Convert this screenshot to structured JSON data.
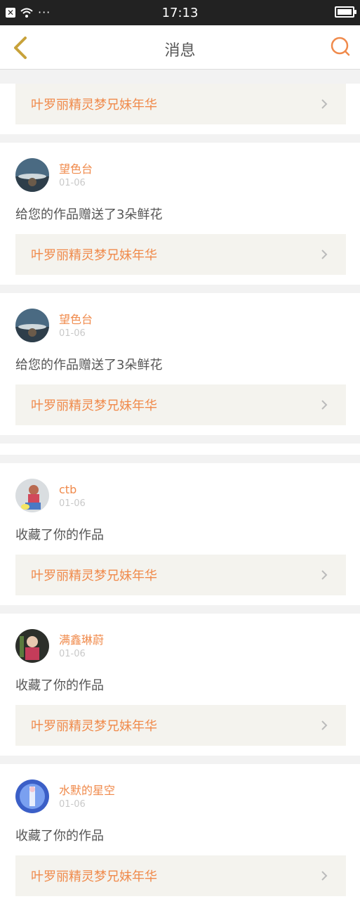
{
  "status": {
    "time": "17:13",
    "x": "✕",
    "dots": "···"
  },
  "nav": {
    "title": "消息",
    "back_icon": "chevron-left-icon",
    "search_icon": "search-icon"
  },
  "colors": {
    "accent": "#f08a4b",
    "card_bg": "#ffffff",
    "page_bg": "#f2f2f2",
    "work_bg": "#f4f3ee"
  },
  "partial_card": {
    "work_title": "叶罗丽精灵梦兄妹年华"
  },
  "notifications": [
    {
      "username": "望色台",
      "date": "01-06",
      "message": "给您的作品赠送了3朵鲜花",
      "work_title": "叶罗丽精灵梦兄妹年华",
      "avatar_icon": "avatar-landscape"
    },
    {
      "username": "望色台",
      "date": "01-06",
      "message": "给您的作品赠送了3朵鲜花",
      "work_title": "叶罗丽精灵梦兄妹年华",
      "avatar_icon": "avatar-landscape"
    },
    {
      "username": "ctb",
      "date": "01-06",
      "message": "收藏了你的作品",
      "work_title": "叶罗丽精灵梦兄妹年华",
      "avatar_icon": "avatar-person"
    },
    {
      "username": "满鑫琳蔚",
      "date": "01-06",
      "message": "收藏了你的作品",
      "work_title": "叶罗丽精灵梦兄妹年华",
      "avatar_icon": "avatar-person-dark"
    },
    {
      "username": "水默的星空",
      "date": "01-06",
      "message": "收藏了你的作品",
      "work_title": "叶罗丽精灵梦兄妹年华",
      "avatar_icon": "avatar-blue"
    }
  ]
}
